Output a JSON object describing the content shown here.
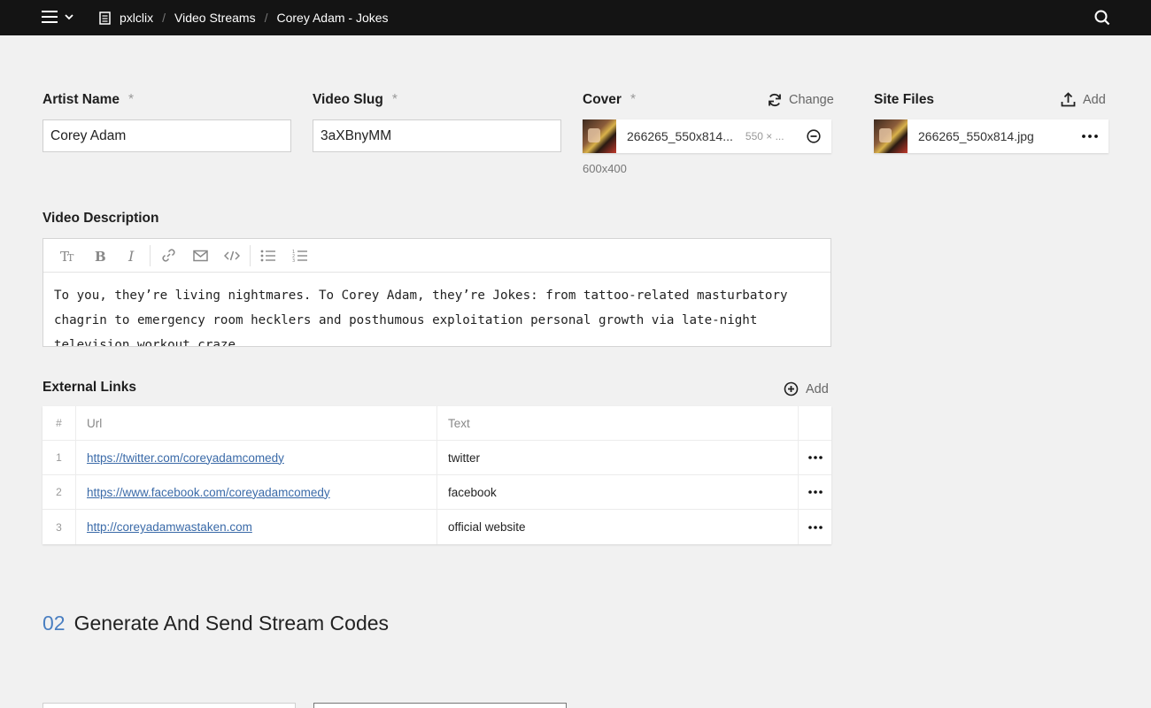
{
  "header": {
    "breadcrumbs": [
      "pxlclix",
      "Video Streams",
      "Corey Adam - Jokes"
    ]
  },
  "form": {
    "artist_name": {
      "label": "Artist Name",
      "required": "*",
      "value": "Corey Adam"
    },
    "video_slug": {
      "label": "Video Slug",
      "required": "*",
      "value": "3aXBnyMM"
    },
    "cover": {
      "label": "Cover",
      "required": "*",
      "action_label": "Change",
      "file_name": "266265_550x814...",
      "file_size": "550 × ...",
      "dimension_note": "600x400"
    },
    "site_files": {
      "label": "Site Files",
      "action_label": "Add",
      "file_name": "266265_550x814.jpg"
    },
    "video_description": {
      "label": "Video Description",
      "toolbar": [
        "text-size-icon",
        "bold-icon",
        "italic-icon",
        "link-icon",
        "email-icon",
        "code-icon",
        "bullet-list-icon",
        "numbered-list-icon"
      ],
      "text": "To you, they’re living nightmares. To Corey Adam, they’re Jokes: from tattoo-related masturbatory chagrin to emergency room hecklers and posthumous exploitation personal growth via late-night television workout craze."
    },
    "external_links": {
      "label": "External Links",
      "action_label": "Add",
      "columns": {
        "index": "#",
        "url": "Url",
        "text": "Text"
      },
      "rows": [
        {
          "index": "1",
          "url": "https://twitter.com/coreyadamcomedy",
          "text": "twitter"
        },
        {
          "index": "2",
          "url": "https://www.facebook.com/coreyadamcomedy",
          "text": "facebook"
        },
        {
          "index": "3",
          "url": "http://coreyadamwastaken.com",
          "text": "official website"
        }
      ]
    }
  },
  "section2": {
    "number": "02",
    "title": "Generate And Send Stream Codes"
  },
  "colors": {
    "topbar": "#141414",
    "accent": "#4a7fc1",
    "link": "#3a6aa8",
    "background": "#f1f1f1"
  }
}
